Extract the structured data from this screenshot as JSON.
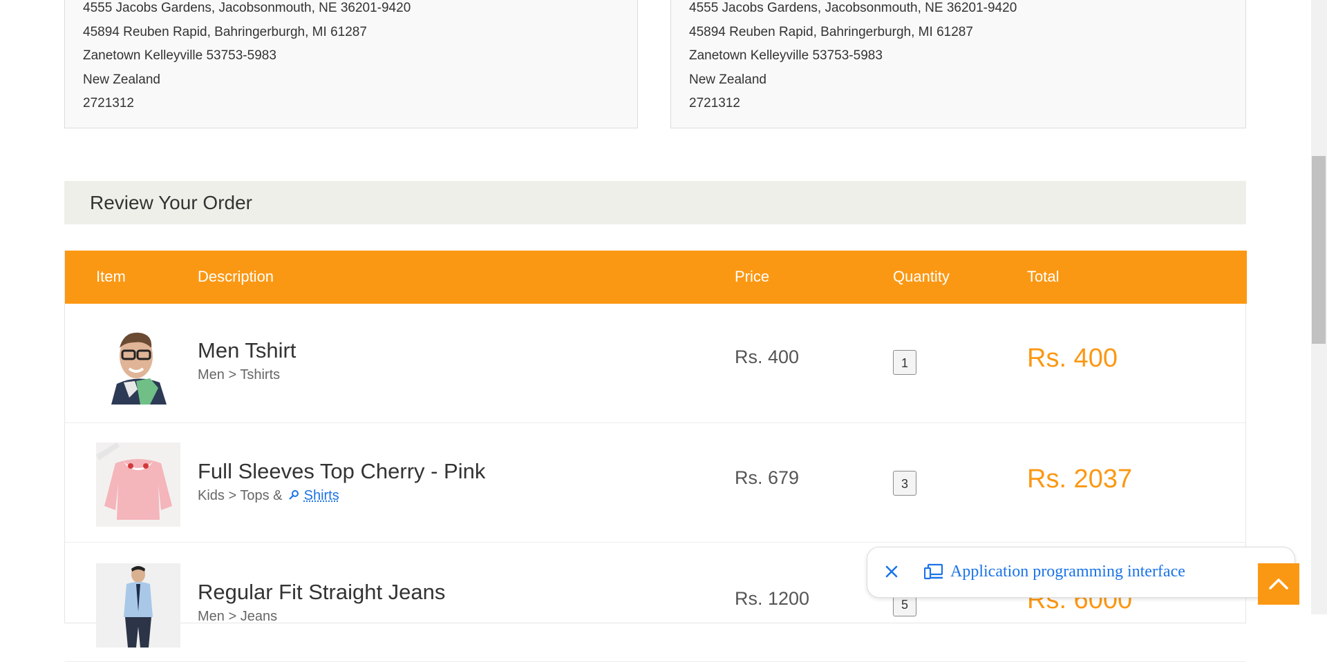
{
  "billing_address": {
    "lines": [
      "4555 Jacobs Gardens, Jacobsonmouth, NE 36201-9420",
      "45894 Reuben Rapid, Bahringerburgh, MI 61287",
      "Zanetown Kelleyville 53753-5983",
      "New Zealand",
      "2721312"
    ]
  },
  "shipping_address": {
    "lines": [
      "4555 Jacobs Gardens, Jacobsonmouth, NE 36201-9420",
      "45894 Reuben Rapid, Bahringerburgh, MI 61287",
      "Zanetown Kelleyville 53753-5983",
      "New Zealand",
      "2721312"
    ]
  },
  "review": {
    "title": "Review Your Order",
    "headers": {
      "item": "Item",
      "description": "Description",
      "price": "Price",
      "quantity": "Quantity",
      "total": "Total"
    },
    "rows": [
      {
        "name": "Men Tshirt",
        "category": "Men > Tshirts",
        "price": "Rs. 400",
        "quantity": "1",
        "total": "Rs. 400"
      },
      {
        "name": "Full Sleeves Top Cherry - Pink",
        "category_prefix": "Kids > Tops &",
        "category_link": "Shirts",
        "price": "Rs. 679",
        "quantity": "3",
        "total": "Rs. 2037"
      },
      {
        "name": "Regular Fit Straight Jeans",
        "category": "Men > Jeans",
        "price": "Rs. 1200",
        "quantity": "5",
        "total": "Rs. 6000"
      }
    ]
  },
  "popup": {
    "text": "Application programming interface",
    "icon": "devices-icon"
  },
  "colors": {
    "accent": "#fb9813",
    "review_header_bg": "#efefea",
    "link": "#1a73e8"
  }
}
